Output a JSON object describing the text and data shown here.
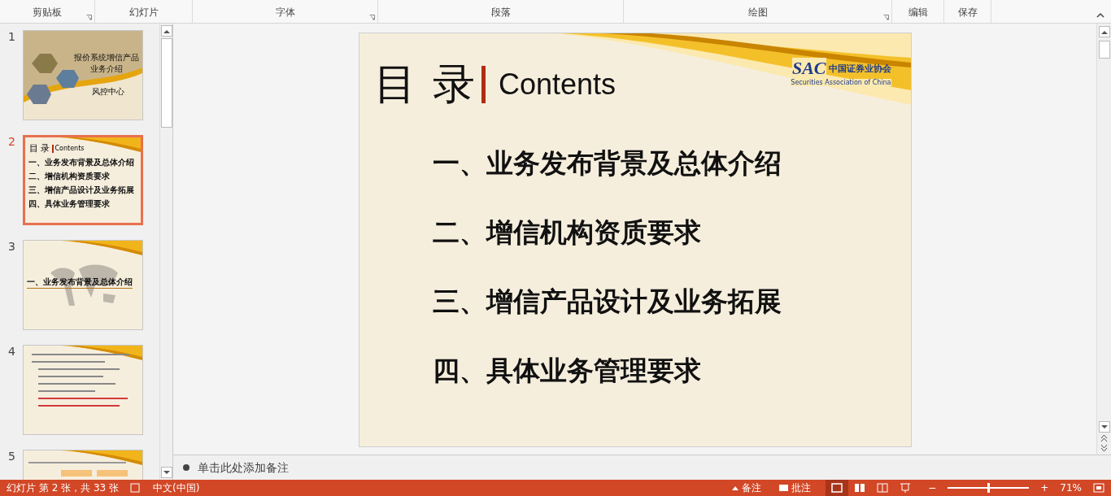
{
  "ribbon": {
    "groups": [
      {
        "label": "剪贴板",
        "launcher": true
      },
      {
        "label": "幻灯片",
        "launcher": false
      },
      {
        "label": "字体",
        "launcher": true
      },
      {
        "label": "段落",
        "launcher": false
      },
      {
        "label": "绘图",
        "launcher": true
      },
      {
        "label": "编辑",
        "launcher": false
      },
      {
        "label": "保存",
        "launcher": false
      }
    ]
  },
  "thumbnails": [
    {
      "number": "1",
      "selected": false,
      "kind": "cover",
      "title": "报价系统增信产品业务介绍",
      "caption": "风控中心"
    },
    {
      "number": "2",
      "selected": true,
      "kind": "contents",
      "title": "目 录",
      "subtitle": "Contents",
      "items": [
        "一、业务发布背景及总体介绍",
        "二、增信机构资质要求",
        "三、增信产品设计及业务拓展",
        "四、具体业务管理要求"
      ]
    },
    {
      "number": "3",
      "selected": false,
      "kind": "section",
      "title": "一、业务发布背景及总体介绍"
    },
    {
      "number": "4",
      "selected": false,
      "kind": "text"
    },
    {
      "number": "5",
      "selected": false,
      "kind": "table"
    }
  ],
  "slide": {
    "title": "目 录",
    "subtitle": "Contents",
    "logo": "SAC",
    "logo_cn": "中国证券业协会",
    "logo_en": "Securities Association of China",
    "items": [
      "一、业务发布背景及总体介绍",
      "二、增信机构资质要求",
      "三、增信产品设计及业务拓展",
      "四、具体业务管理要求"
    ]
  },
  "notes": {
    "placeholder": "单击此处添加备注"
  },
  "status_bar": {
    "slide_info": "幻灯片 第 2 张，共 33 张",
    "language": "中文(中国)",
    "notes_button": "备注",
    "comments_button": "批注",
    "zoom_out": "−",
    "zoom_in": "+",
    "zoom_slider": {
      "level": 0.5
    },
    "zoom": "71%"
  }
}
